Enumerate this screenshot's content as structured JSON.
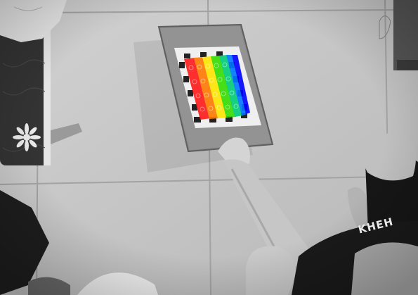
{
  "scene": {
    "shirt_print": "KHEH"
  },
  "colors": {
    "floor": "#c9c9c9",
    "tile_grout": "#9a9a9a",
    "board": "#8e8e8e",
    "board_edge": "#5e5e5e",
    "card": "#efefef",
    "square": "#2b2b2b",
    "overlay": [
      "#ff0000",
      "#ff7a00",
      "#ffe600",
      "#33dd00",
      "#00cc77",
      "#0077ff",
      "#0000ff"
    ]
  },
  "icons": {
    "mattress_pattern": "flower-icon"
  }
}
